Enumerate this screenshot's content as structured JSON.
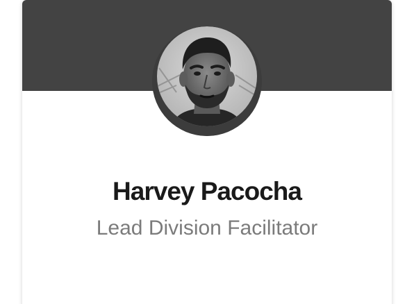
{
  "profile": {
    "name": "Harvey Pacocha",
    "title": "Lead Division Facilitator",
    "avatar_icon": "person-photo-avatar"
  },
  "colors": {
    "header_bg": "#434343",
    "name_text": "#1a1a1a",
    "title_text": "#7b7b7b",
    "card_bg": "#ffffff"
  }
}
